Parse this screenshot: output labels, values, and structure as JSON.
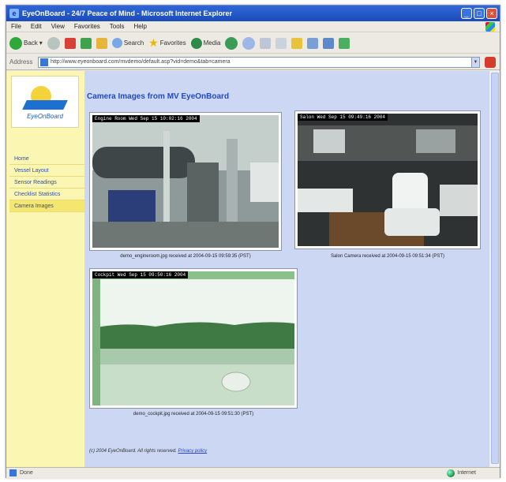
{
  "window": {
    "title": "EyeOnBoard - 24/7 Peace of Mind - Microsoft Internet Explorer"
  },
  "menubar": [
    "File",
    "Edit",
    "View",
    "Favorites",
    "Tools",
    "Help"
  ],
  "toolbar": {
    "back_label": "Back",
    "search_label": "Search",
    "favorites_label": "Favorites",
    "media_label": "Media"
  },
  "address": {
    "label": "Address",
    "url": "http://www.eyeonboard.com/mvdemo/default.asp?vid=demo&tab=camera"
  },
  "logo": {
    "text": "EyeOnBoard"
  },
  "nav": [
    "Home",
    "Vessel Layout",
    "Sensor Readings",
    "Checklist Statistics",
    "Camera Images"
  ],
  "nav_active": 4,
  "page": {
    "title": "Camera Images from MV EyeOnBoard"
  },
  "cameras": [
    {
      "stamp": "Engine Room  Wed Sep 15 10:02:16  2004",
      "caption": "demo_engineroom.jpg received at 2004-09-15 09:59:35 (PST)"
    },
    {
      "stamp": "Salon  Wed Sep 15  09:49:16  2004",
      "caption": "Salon Camera received at 2004-09-15 09:51:34 (PST)"
    },
    {
      "stamp": "Cockpit  Wed Sep 15 09:50:16  2004",
      "caption": "demo_cockpit.jpg received at 2004-09-15 09:51:30 (PST)"
    }
  ],
  "footer": {
    "text": "(c) 2004 EyeOnBoard. All rights reserved.",
    "link": "Privacy policy"
  },
  "statusbar": {
    "left": "Done",
    "zone": "Internet"
  }
}
